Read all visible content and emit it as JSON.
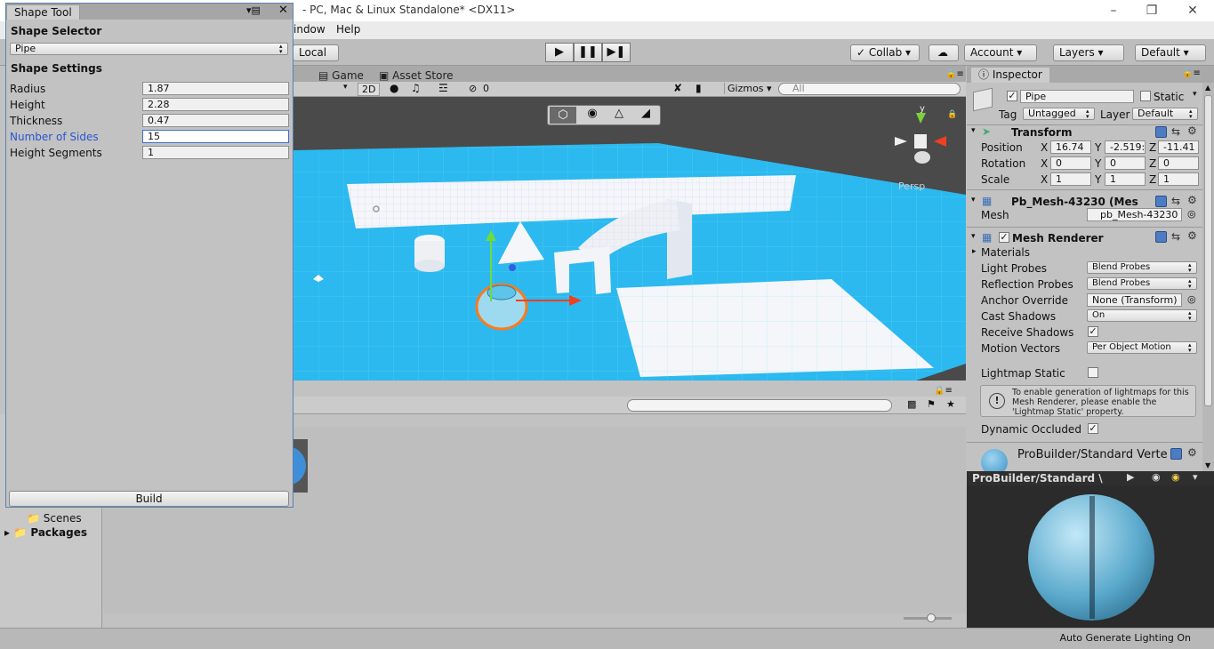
{
  "window": {
    "title": "- PC, Mac & Linux Standalone* <DX11>"
  },
  "menu": {
    "window": "indow",
    "help": "Help"
  },
  "toolbar": {
    "local": "Local",
    "collab": "Collab",
    "account": "Account",
    "layers": "Layers",
    "layout": "Default"
  },
  "tabs": {
    "game": "Game",
    "asset_store": "Asset Store",
    "inspector": "Inspector"
  },
  "scenebar": {
    "mode_2d": "2D",
    "hidden_count": "0",
    "gizmos": "Gizmos",
    "search_placeholder": "All"
  },
  "scene": {
    "persp": "Persp",
    "axis_y": "y"
  },
  "shape_tool": {
    "title": "Shape Tool",
    "selector_header": "Shape Selector",
    "selected_shape": "Pipe",
    "settings_header": "Shape Settings",
    "fields": [
      {
        "label": "Radius",
        "value": "1.87"
      },
      {
        "label": "Height",
        "value": "2.28"
      },
      {
        "label": "Thickness",
        "value": "0.47"
      },
      {
        "label": "Number of Sides",
        "value": "15"
      },
      {
        "label": "Height Segments",
        "value": "1"
      }
    ],
    "build": "Build"
  },
  "project": {
    "scenes": "Scenes",
    "packages": "Packages"
  },
  "inspector": {
    "name": "Pipe",
    "static": "Static",
    "tag_label": "Tag",
    "tag": "Untagged",
    "layer_label": "Layer",
    "layer": "Default",
    "transform": {
      "title": "Transform",
      "position": {
        "label": "Position",
        "x": "16.74",
        "y": "-2.519:",
        "z": "-11.41"
      },
      "rotation": {
        "label": "Rotation",
        "x": "0",
        "y": "0",
        "z": "0"
      },
      "scale": {
        "label": "Scale",
        "x": "1",
        "y": "1",
        "z": "1"
      }
    },
    "mesh_filter": {
      "title": "Pb_Mesh-43230 (Mes",
      "mesh_label": "Mesh",
      "mesh": "pb_Mesh-43230"
    },
    "mesh_renderer": {
      "title": "Mesh Renderer",
      "materials": "Materials",
      "light_probes": {
        "label": "Light Probes",
        "value": "Blend Probes"
      },
      "reflection_probes": {
        "label": "Reflection Probes",
        "value": "Blend Probes"
      },
      "anchor_override": {
        "label": "Anchor Override",
        "value": "None (Transform)"
      },
      "cast_shadows": {
        "label": "Cast Shadows",
        "value": "On"
      },
      "receive_shadows": "Receive Shadows",
      "motion_vectors": {
        "label": "Motion Vectors",
        "value": "Per Object Motion"
      },
      "lightmap_static": "Lightmap Static",
      "note": "To enable generation of lightmaps for this Mesh Renderer, please enable the 'Lightmap Static' property.",
      "dynamic_occluded": "Dynamic Occluded"
    },
    "material": {
      "title": "ProBuilder/Standard Verte"
    }
  },
  "preview": {
    "title": "ProBuilder/Standard \\"
  },
  "status": {
    "text": "Auto Generate Lighting On"
  }
}
